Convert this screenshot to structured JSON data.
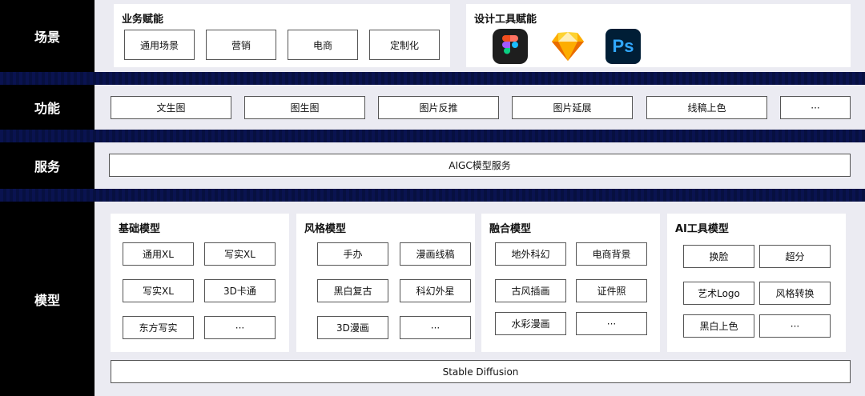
{
  "rows": {
    "scene": "场景",
    "function": "功能",
    "service": "服务",
    "model": "模型"
  },
  "scene": {
    "business_title": "业务赋能",
    "business_items": [
      "通用场景",
      "营销",
      "电商",
      "定制化"
    ],
    "design_title": "设计工具赋能",
    "design_tools": [
      {
        "icon": "figma-icon"
      },
      {
        "icon": "sketch-icon"
      },
      {
        "icon": "photoshop-icon",
        "text": "Ps"
      }
    ]
  },
  "functions": [
    "文生图",
    "图生图",
    "图片反推",
    "图片延展",
    "线稿上色",
    "···"
  ],
  "service": {
    "label": "AIGC模型服务"
  },
  "models": {
    "groups": [
      {
        "title": "基础模型",
        "items": [
          "通用XL",
          "写实XL",
          "写实XL",
          "3D卡通",
          "东方写实",
          "···"
        ]
      },
      {
        "title": "风格模型",
        "items": [
          "手办",
          "漫画线稿",
          "黑白复古",
          "科幻外星",
          "3D漫画",
          "···"
        ]
      },
      {
        "title": "融合模型",
        "items": [
          "地外科幻",
          "电商背景",
          "古风插画",
          "证件照",
          "水彩漫画",
          "···"
        ]
      },
      {
        "title": "AI工具模型",
        "items": [
          "换脸",
          "超分",
          "艺术Logo",
          "风格转换",
          "黑白上色",
          "···"
        ]
      }
    ],
    "base": "Stable Diffusion"
  },
  "colors": {
    "label_bg": "#000000",
    "panel_bg": "#ebebf2",
    "stripe": "#0a1350",
    "ps_bg": "#001e36",
    "ps_fg": "#31a8ff",
    "sketch": "#fdb300"
  }
}
